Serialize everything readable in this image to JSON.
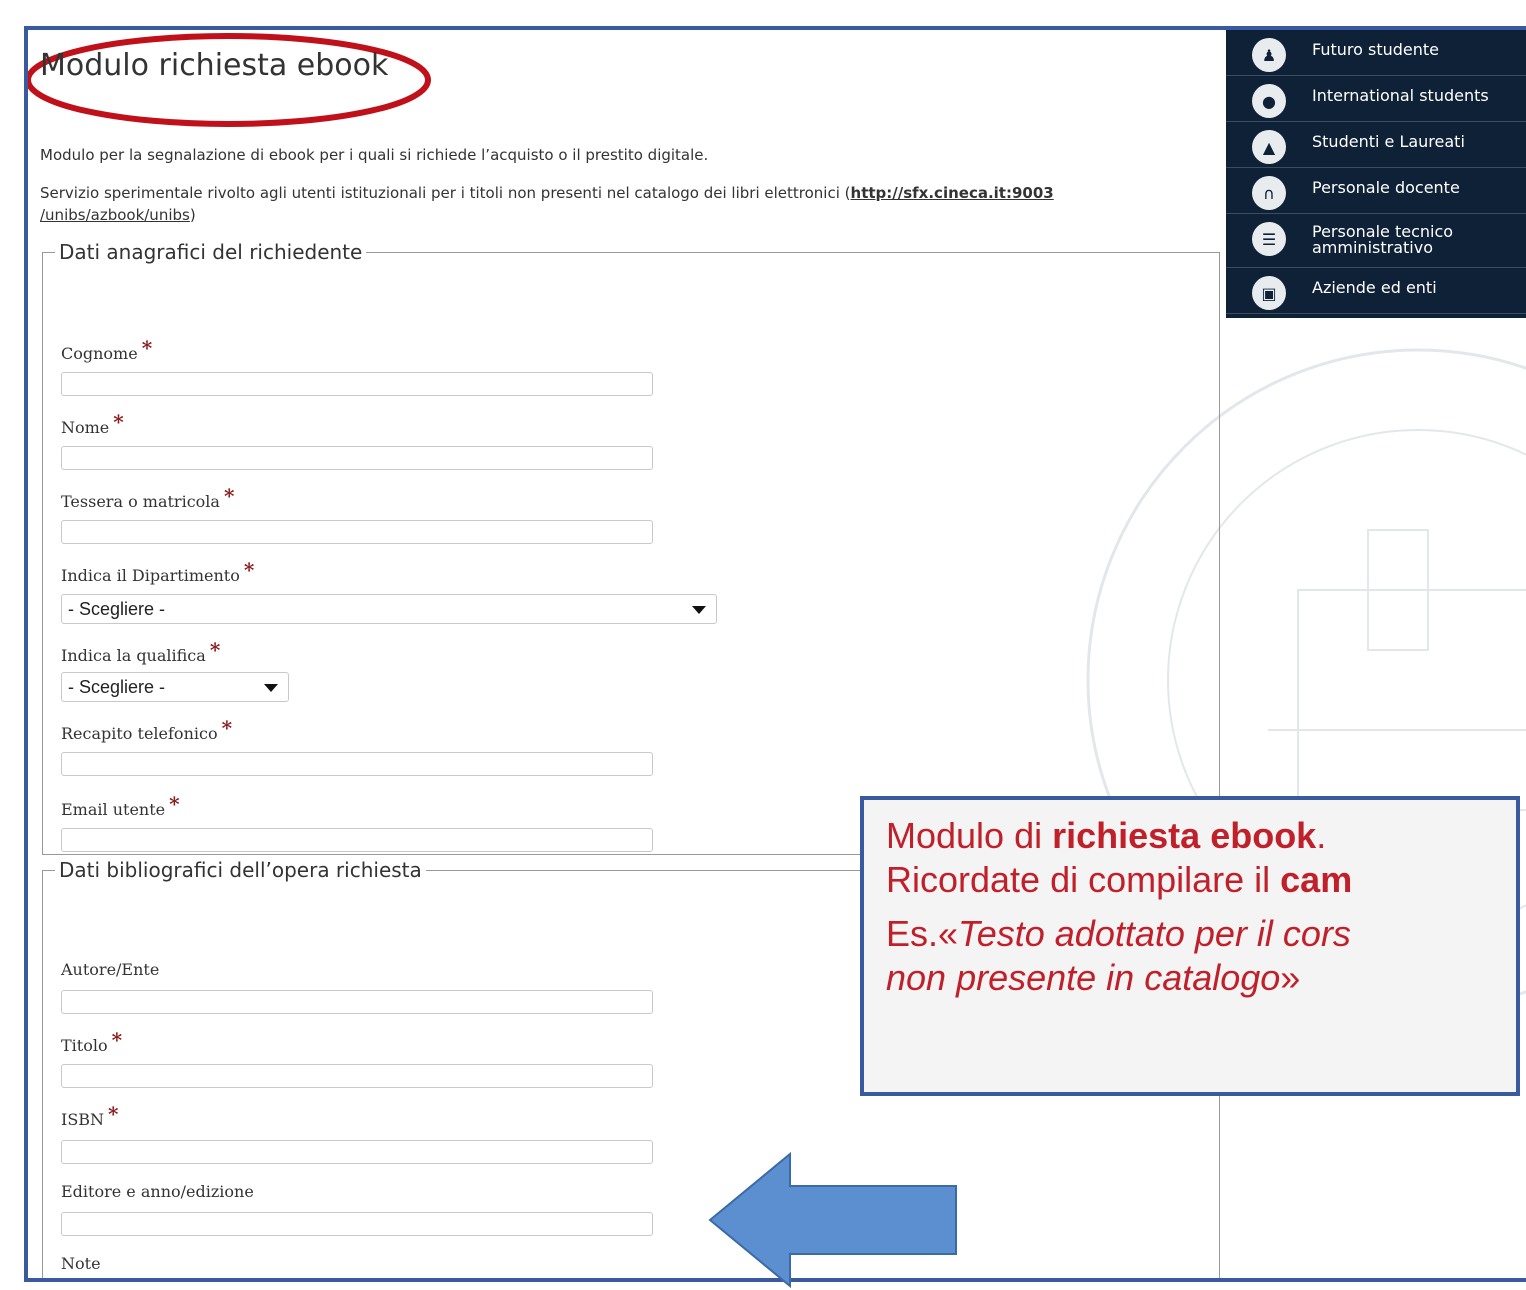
{
  "form": {
    "title": "Modulo richiesta ebook",
    "intro1": "Modulo per la segnalazione di ebook per i quali si richiede l’acquisto o il prestito digitale.",
    "intro2_text": "Servizio sperimentale rivolto agli utenti istituzionali per i titoli non presenti nel catalogo dei libri elettronici (",
    "intro2_link1": "http://sfx.cineca.it:9003",
    "intro2_link2": "/unibs/azbook/unibs",
    "intro2_end": ")",
    "required_mark": "*",
    "section1": {
      "legend": "Dati anagrafici del richiedente",
      "cognome": "Cognome",
      "nome": "Nome",
      "tessera": "Tessera o matricola",
      "dipartimento": "Indica il Dipartimento",
      "dipartimento_value": "- Scegliere -",
      "qualifica": "Indica la qualifica",
      "qualifica_value": "- Scegliere -",
      "telefono": "Recapito telefonico",
      "email": "Email utente"
    },
    "section2": {
      "legend": "Dati bibliografici dell’opera richiesta",
      "autore": "Autore/Ente",
      "titolo": "Titolo",
      "isbn": "ISBN",
      "editore": "Editore e anno/edizione",
      "note": "Note"
    }
  },
  "menu": {
    "items": [
      {
        "label": "Futuro studente",
        "icon": "people-icon"
      },
      {
        "label": "International students",
        "icon": "globe-icon"
      },
      {
        "label": "Studenti e Laureati",
        "icon": "graduation-cap-icon"
      },
      {
        "label": "Personale docente",
        "icon": "building-icon"
      },
      {
        "label": "Personale tecnico",
        "label2": "amministrativo",
        "icon": "books-icon"
      },
      {
        "label": "Aziende ed enti",
        "icon": "briefcase-icon"
      }
    ]
  },
  "callout": {
    "line1_a": "Modulo di ",
    "line1_b": "richiesta ebook",
    "line1_c": ".",
    "line2_a": "Ricordate di compilare il ",
    "line2_b": "cam",
    "line3": "Es.«",
    "line3_i": "Testo adottato per il cors",
    "line4_i": "non presente in catalogo",
    "line4_end": "»"
  },
  "colors": {
    "frame": "#3a5aa0",
    "menu_bg": "#0e2137",
    "required": "#8b1a1a",
    "callout_text": "#c0202a",
    "ellipse": "#c0101a",
    "arrow": "#5b8fd0"
  }
}
